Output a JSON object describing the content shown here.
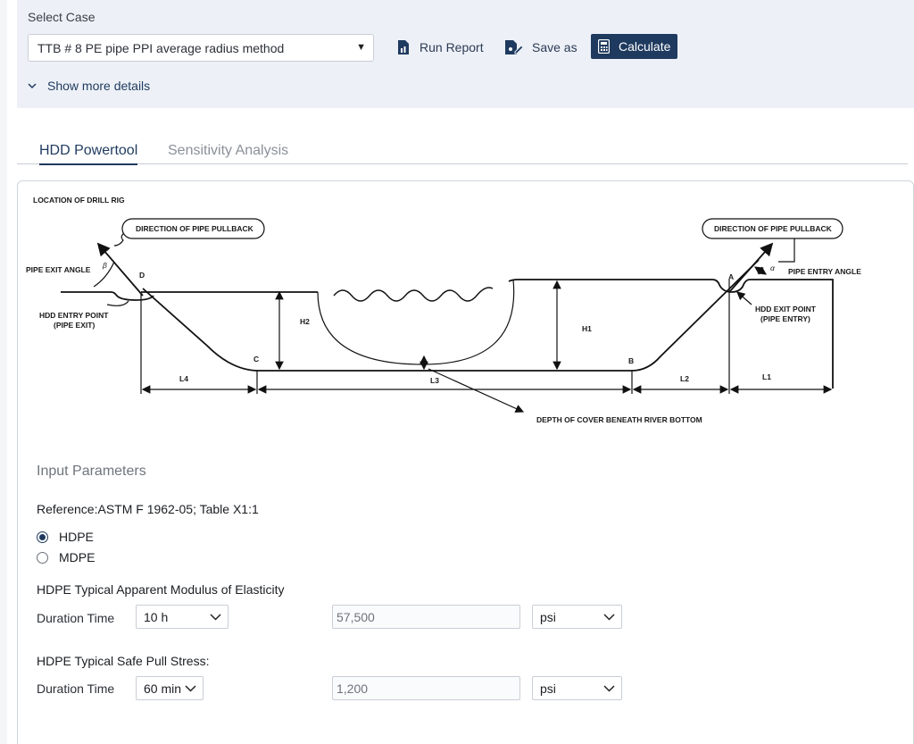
{
  "header": {
    "select_case_label": "Select Case",
    "case_value": "TTB # 8 PE pipe PPI average radius method",
    "run_report_label": "Run Report",
    "save_as_label": "Save as",
    "calculate_label": "Calculate",
    "show_more_label": "Show more details"
  },
  "tabs": [
    {
      "label": "HDD Powertool",
      "active": true
    },
    {
      "label": "Sensitivity Analysis",
      "active": false
    }
  ],
  "diagram": {
    "location_label": "LOCATION OF DRILL RIG",
    "pullback_left": "DIRECTION OF PIPE PULLBACK",
    "pullback_right": "DIRECTION OF PIPE PULLBACK",
    "pipe_exit_angle": "PIPE EXIT ANGLE",
    "pipe_entry_angle": "PIPE ENTRY ANGLE",
    "entry_point_line1": "HDD ENTRY POINT",
    "entry_point_line2": "(PIPE EXIT)",
    "exit_point_line1": "HDD EXIT POINT",
    "exit_point_line2": "(PIPE ENTRY)",
    "depth_cover": "DEPTH OF COVER BENEATH RIVER BOTTOM",
    "beta": "β",
    "alpha": "α",
    "pt_a": "A",
    "pt_b": "B",
    "pt_c": "C",
    "pt_d": "D",
    "h1": "H1",
    "h2": "H2",
    "l1": "L1",
    "l2": "L2",
    "l3": "L3",
    "l4": "L4"
  },
  "inputs": {
    "section_title": "Input Parameters",
    "reference": "Reference:ASTM F 1962-05; Table X1:1",
    "material_options": [
      {
        "label": "HDPE",
        "selected": true
      },
      {
        "label": "MDPE",
        "selected": false
      }
    ],
    "modulus_heading": "HDPE Typical Apparent Modulus of Elasticity",
    "modulus_duration_label": "Duration Time",
    "modulus_duration_value": "10 h",
    "modulus_value": "57,500",
    "modulus_unit": "psi",
    "stress_heading": "HDPE Typical Safe Pull Stress:",
    "stress_duration_label": "Duration Time",
    "stress_duration_value": "60 min",
    "stress_value": "1,200",
    "stress_unit": "psi"
  },
  "colors": {
    "accent": "#1f3a5f",
    "header_bg": "#edf1f7"
  }
}
